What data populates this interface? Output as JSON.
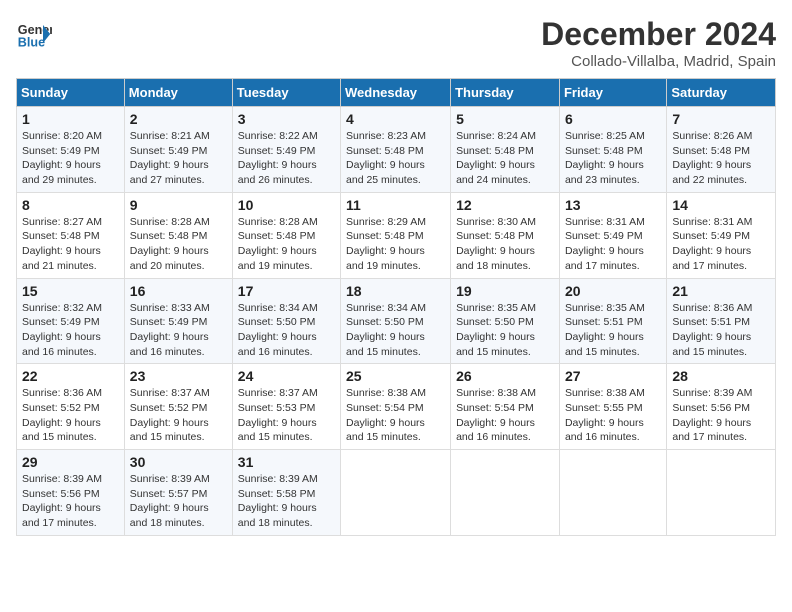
{
  "header": {
    "logo_line1": "General",
    "logo_line2": "Blue",
    "title": "December 2024",
    "subtitle": "Collado-Villalba, Madrid, Spain"
  },
  "days_of_week": [
    "Sunday",
    "Monday",
    "Tuesday",
    "Wednesday",
    "Thursday",
    "Friday",
    "Saturday"
  ],
  "weeks": [
    [
      {
        "day": "1",
        "sunrise": "8:20 AM",
        "sunset": "5:49 PM",
        "daylight": "9 hours and 29 minutes."
      },
      {
        "day": "2",
        "sunrise": "8:21 AM",
        "sunset": "5:49 PM",
        "daylight": "9 hours and 27 minutes."
      },
      {
        "day": "3",
        "sunrise": "8:22 AM",
        "sunset": "5:49 PM",
        "daylight": "9 hours and 26 minutes."
      },
      {
        "day": "4",
        "sunrise": "8:23 AM",
        "sunset": "5:48 PM",
        "daylight": "9 hours and 25 minutes."
      },
      {
        "day": "5",
        "sunrise": "8:24 AM",
        "sunset": "5:48 PM",
        "daylight": "9 hours and 24 minutes."
      },
      {
        "day": "6",
        "sunrise": "8:25 AM",
        "sunset": "5:48 PM",
        "daylight": "9 hours and 23 minutes."
      },
      {
        "day": "7",
        "sunrise": "8:26 AM",
        "sunset": "5:48 PM",
        "daylight": "9 hours and 22 minutes."
      }
    ],
    [
      {
        "day": "8",
        "sunrise": "8:27 AM",
        "sunset": "5:48 PM",
        "daylight": "9 hours and 21 minutes."
      },
      {
        "day": "9",
        "sunrise": "8:28 AM",
        "sunset": "5:48 PM",
        "daylight": "9 hours and 20 minutes."
      },
      {
        "day": "10",
        "sunrise": "8:28 AM",
        "sunset": "5:48 PM",
        "daylight": "9 hours and 19 minutes."
      },
      {
        "day": "11",
        "sunrise": "8:29 AM",
        "sunset": "5:48 PM",
        "daylight": "9 hours and 19 minutes."
      },
      {
        "day": "12",
        "sunrise": "8:30 AM",
        "sunset": "5:48 PM",
        "daylight": "9 hours and 18 minutes."
      },
      {
        "day": "13",
        "sunrise": "8:31 AM",
        "sunset": "5:49 PM",
        "daylight": "9 hours and 17 minutes."
      },
      {
        "day": "14",
        "sunrise": "8:31 AM",
        "sunset": "5:49 PM",
        "daylight": "9 hours and 17 minutes."
      }
    ],
    [
      {
        "day": "15",
        "sunrise": "8:32 AM",
        "sunset": "5:49 PM",
        "daylight": "9 hours and 16 minutes."
      },
      {
        "day": "16",
        "sunrise": "8:33 AM",
        "sunset": "5:49 PM",
        "daylight": "9 hours and 16 minutes."
      },
      {
        "day": "17",
        "sunrise": "8:34 AM",
        "sunset": "5:50 PM",
        "daylight": "9 hours and 16 minutes."
      },
      {
        "day": "18",
        "sunrise": "8:34 AM",
        "sunset": "5:50 PM",
        "daylight": "9 hours and 15 minutes."
      },
      {
        "day": "19",
        "sunrise": "8:35 AM",
        "sunset": "5:50 PM",
        "daylight": "9 hours and 15 minutes."
      },
      {
        "day": "20",
        "sunrise": "8:35 AM",
        "sunset": "5:51 PM",
        "daylight": "9 hours and 15 minutes."
      },
      {
        "day": "21",
        "sunrise": "8:36 AM",
        "sunset": "5:51 PM",
        "daylight": "9 hours and 15 minutes."
      }
    ],
    [
      {
        "day": "22",
        "sunrise": "8:36 AM",
        "sunset": "5:52 PM",
        "daylight": "9 hours and 15 minutes."
      },
      {
        "day": "23",
        "sunrise": "8:37 AM",
        "sunset": "5:52 PM",
        "daylight": "9 hours and 15 minutes."
      },
      {
        "day": "24",
        "sunrise": "8:37 AM",
        "sunset": "5:53 PM",
        "daylight": "9 hours and 15 minutes."
      },
      {
        "day": "25",
        "sunrise": "8:38 AM",
        "sunset": "5:54 PM",
        "daylight": "9 hours and 15 minutes."
      },
      {
        "day": "26",
        "sunrise": "8:38 AM",
        "sunset": "5:54 PM",
        "daylight": "9 hours and 16 minutes."
      },
      {
        "day": "27",
        "sunrise": "8:38 AM",
        "sunset": "5:55 PM",
        "daylight": "9 hours and 16 minutes."
      },
      {
        "day": "28",
        "sunrise": "8:39 AM",
        "sunset": "5:56 PM",
        "daylight": "9 hours and 17 minutes."
      }
    ],
    [
      {
        "day": "29",
        "sunrise": "8:39 AM",
        "sunset": "5:56 PM",
        "daylight": "9 hours and 17 minutes."
      },
      {
        "day": "30",
        "sunrise": "8:39 AM",
        "sunset": "5:57 PM",
        "daylight": "9 hours and 18 minutes."
      },
      {
        "day": "31",
        "sunrise": "8:39 AM",
        "sunset": "5:58 PM",
        "daylight": "9 hours and 18 minutes."
      },
      null,
      null,
      null,
      null
    ]
  ]
}
